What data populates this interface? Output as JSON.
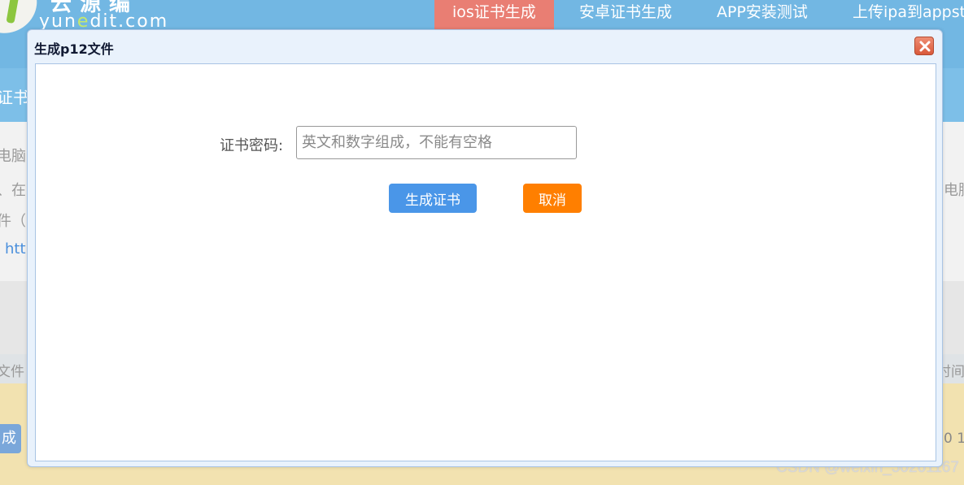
{
  "site": {
    "logo_cn": "云源编",
    "logo_en_pre": "yun",
    "logo_en_accent": "e",
    "logo_en_post": "dit.com",
    "colors": {
      "header": "#72b7e3",
      "active_nav": "#e97e73"
    }
  },
  "nav": {
    "items": [
      {
        "label": "ios证书生成",
        "active": true
      },
      {
        "label": "安卓证书生成",
        "active": false
      },
      {
        "label": "APP安装测试",
        "active": false
      },
      {
        "label": "上传ipa到appst",
        "active": false
      }
    ]
  },
  "background": {
    "band_text": "证书",
    "left_lines": [
      "电脑的",
      "、在",
      "件（",
      "htt"
    ],
    "right_line": "电脑",
    "table_left": "文件",
    "table_right": "时间",
    "bottom_button": "成",
    "bottom_right_num": "0 1"
  },
  "watermark": "CSDN @weixin_50261167",
  "dialog": {
    "title": "生成p12文件",
    "close_icon": "close-x-icon",
    "field_label": "证书密码:",
    "password_value": "",
    "password_placeholder": "英文和数字组成，不能有空格",
    "generate_label": "生成证书",
    "cancel_label": "取消",
    "colors": {
      "generate": "#4a96e8",
      "cancel": "#ff7f00",
      "close": "#e06a4b"
    }
  }
}
